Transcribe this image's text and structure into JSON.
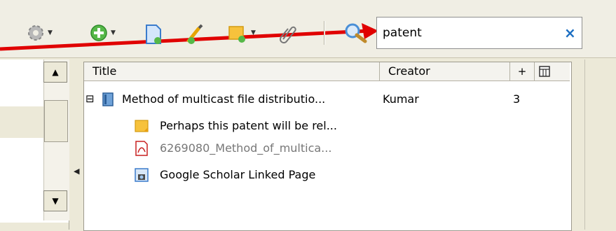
{
  "toolbar": {
    "icons": [
      "gear-icon",
      "new-item-icon",
      "new-item-from-identifier-icon",
      "new-note-icon",
      "add-attachment-icon",
      "attachment-link-icon",
      "search-icon"
    ]
  },
  "search": {
    "value": "patent",
    "clear_glyph": "×"
  },
  "columns": {
    "title": "Title",
    "creator": "Creator",
    "add": "+"
  },
  "rows": [
    {
      "title": "Method of multicast file distributio...",
      "creator": "Kumar",
      "count": "3",
      "expander": "⊟"
    },
    {
      "title": "Perhaps this patent will be rel..."
    },
    {
      "title": "6269080_Method_of_multica..."
    },
    {
      "title": "Google Scholar Linked Page"
    }
  ],
  "annotation": {
    "arrow_color": "#e00000"
  }
}
